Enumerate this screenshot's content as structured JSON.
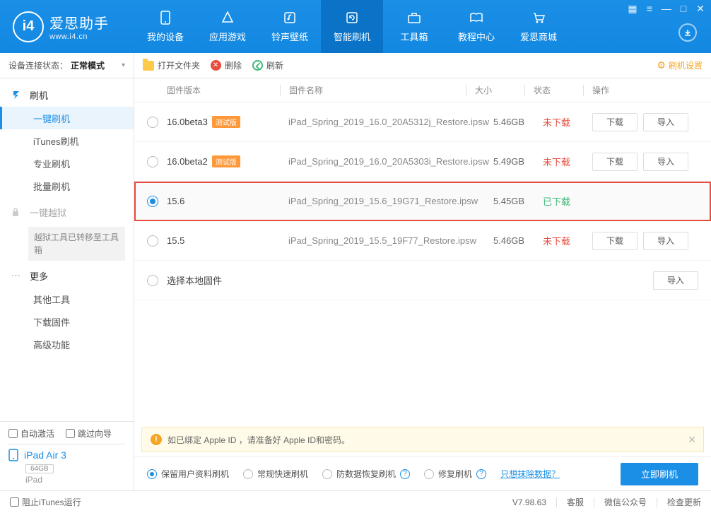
{
  "app": {
    "name": "爱思助手",
    "url": "www.i4.cn"
  },
  "nav": [
    {
      "label": "我的设备"
    },
    {
      "label": "应用游戏"
    },
    {
      "label": "铃声壁纸"
    },
    {
      "label": "智能刷机"
    },
    {
      "label": "工具箱"
    },
    {
      "label": "教程中心"
    },
    {
      "label": "爱思商城"
    }
  ],
  "sidebar": {
    "status_label": "设备连接状态：",
    "status_value": "正常模式",
    "flash": {
      "head": "刷机",
      "items": [
        "一键刷机",
        "iTunes刷机",
        "专业刷机",
        "批量刷机"
      ]
    },
    "jailbreak": {
      "head": "一键越狱",
      "note": "越狱工具已转移至工具箱"
    },
    "more": {
      "head": "更多",
      "items": [
        "其他工具",
        "下载固件",
        "高级功能"
      ]
    },
    "auto_activate": "自动激活",
    "skip_guide": "跳过向导",
    "device_name": "iPad Air 3",
    "device_capacity": "64GB",
    "device_type": "iPad"
  },
  "toolbar": {
    "open_folder": "打开文件夹",
    "delete": "删除",
    "refresh": "刷新",
    "settings": "刷机设置"
  },
  "table": {
    "headers": {
      "version": "固件版本",
      "name": "固件名称",
      "size": "大小",
      "status": "状态",
      "ops": "操作"
    },
    "btn_download": "下载",
    "btn_import": "导入",
    "status_not_downloaded": "未下载",
    "status_downloaded": "已下载",
    "local_firmware": "选择本地固件",
    "rows": [
      {
        "version": "16.0beta3",
        "beta": "测试版",
        "name": "iPad_Spring_2019_16.0_20A5312j_Restore.ipsw",
        "size": "5.46GB",
        "downloaded": false,
        "selected": false,
        "buttons": true
      },
      {
        "version": "16.0beta2",
        "beta": "测试版",
        "name": "iPad_Spring_2019_16.0_20A5303i_Restore.ipsw",
        "size": "5.49GB",
        "downloaded": false,
        "selected": false,
        "buttons": true
      },
      {
        "version": "15.6",
        "beta": "",
        "name": "iPad_Spring_2019_15.6_19G71_Restore.ipsw",
        "size": "5.45GB",
        "downloaded": true,
        "selected": true,
        "buttons": false
      },
      {
        "version": "15.5",
        "beta": "",
        "name": "iPad_Spring_2019_15.5_19F77_Restore.ipsw",
        "size": "5.46GB",
        "downloaded": false,
        "selected": false,
        "buttons": true
      }
    ]
  },
  "warning": "如已绑定 Apple ID ，请准备好 Apple ID和密码。",
  "options": {
    "keep_data": "保留用户资料刷机",
    "quick": "常规快速刷机",
    "anti_recovery": "防数据恢复刷机",
    "repair": "修复刷机",
    "erase_link": "只想抹除数据？",
    "flash_now": "立即刷机"
  },
  "footer": {
    "block_itunes": "阻止iTunes运行",
    "version": "V7.98.63",
    "support": "客服",
    "wechat": "微信公众号",
    "update": "检查更新"
  }
}
